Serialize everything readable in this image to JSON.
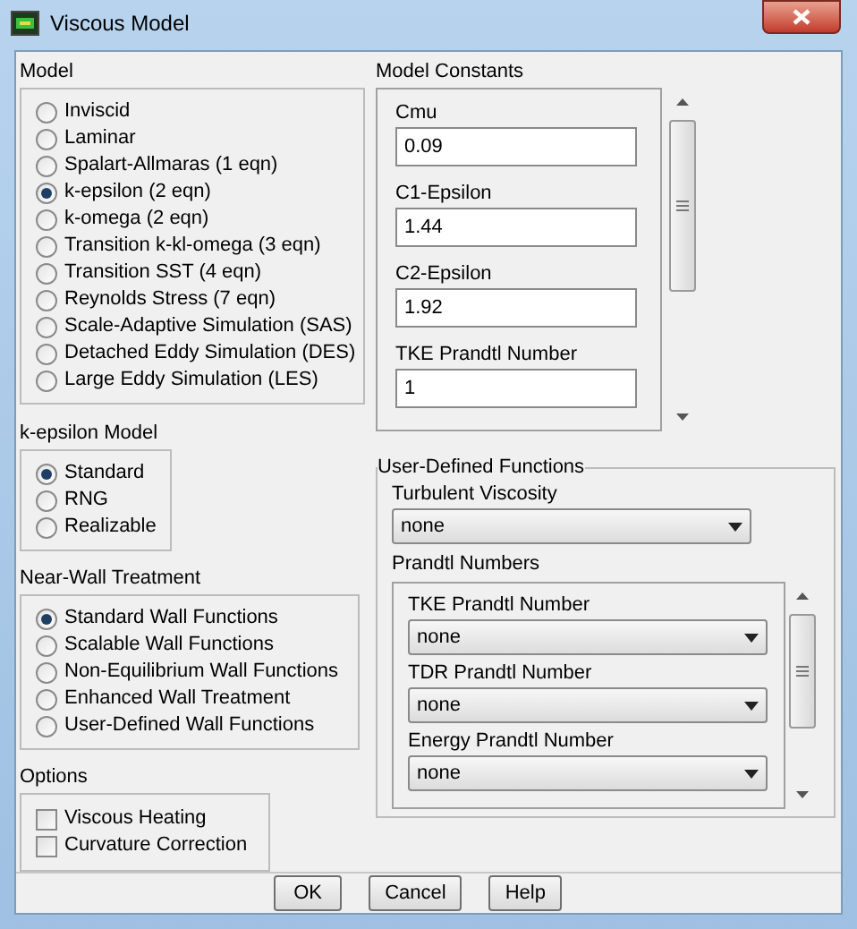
{
  "window": {
    "title": "Viscous Model"
  },
  "model": {
    "label": "Model",
    "options": [
      {
        "label": "Inviscid",
        "selected": false
      },
      {
        "label": "Laminar",
        "selected": false
      },
      {
        "label": "Spalart-Allmaras (1 eqn)",
        "selected": false
      },
      {
        "label": "k-epsilon (2 eqn)",
        "selected": true
      },
      {
        "label": "k-omega (2 eqn)",
        "selected": false
      },
      {
        "label": "Transition k-kl-omega (3 eqn)",
        "selected": false
      },
      {
        "label": "Transition SST (4 eqn)",
        "selected": false
      },
      {
        "label": "Reynolds Stress (7 eqn)",
        "selected": false
      },
      {
        "label": "Scale-Adaptive Simulation (SAS)",
        "selected": false
      },
      {
        "label": "Detached Eddy Simulation (DES)",
        "selected": false
      },
      {
        "label": "Large Eddy Simulation (LES)",
        "selected": false
      }
    ]
  },
  "k_epsilon_model": {
    "label": "k-epsilon Model",
    "options": [
      {
        "label": "Standard",
        "selected": true
      },
      {
        "label": "RNG",
        "selected": false
      },
      {
        "label": "Realizable",
        "selected": false
      }
    ]
  },
  "near_wall_treatment": {
    "label": "Near-Wall Treatment",
    "options": [
      {
        "label": "Standard Wall Functions",
        "selected": true
      },
      {
        "label": "Scalable Wall Functions",
        "selected": false
      },
      {
        "label": "Non-Equilibrium Wall Functions",
        "selected": false
      },
      {
        "label": "Enhanced Wall Treatment",
        "selected": false
      },
      {
        "label": "User-Defined Wall Functions",
        "selected": false
      }
    ]
  },
  "options": {
    "label": "Options",
    "items": [
      {
        "label": "Viscous Heating",
        "checked": false
      },
      {
        "label": "Curvature Correction",
        "checked": false
      }
    ]
  },
  "model_constants": {
    "label": "Model Constants",
    "fields": [
      {
        "label": "Cmu",
        "value": "0.09"
      },
      {
        "label": "C1-Epsilon",
        "value": "1.44"
      },
      {
        "label": "C2-Epsilon",
        "value": "1.92"
      },
      {
        "label": "TKE Prandtl Number",
        "value": "1"
      }
    ]
  },
  "user_defined_functions": {
    "label": "User-Defined Functions",
    "turbulent_viscosity": {
      "label": "Turbulent Viscosity",
      "value": "none"
    },
    "prandtl_numbers": {
      "label": "Prandtl Numbers",
      "fields": [
        {
          "label": "TKE Prandtl Number",
          "value": "none"
        },
        {
          "label": "TDR Prandtl Number",
          "value": "none"
        },
        {
          "label": "Energy Prandtl Number",
          "value": "none"
        }
      ]
    }
  },
  "buttons": [
    "OK",
    "Cancel",
    "Help"
  ]
}
